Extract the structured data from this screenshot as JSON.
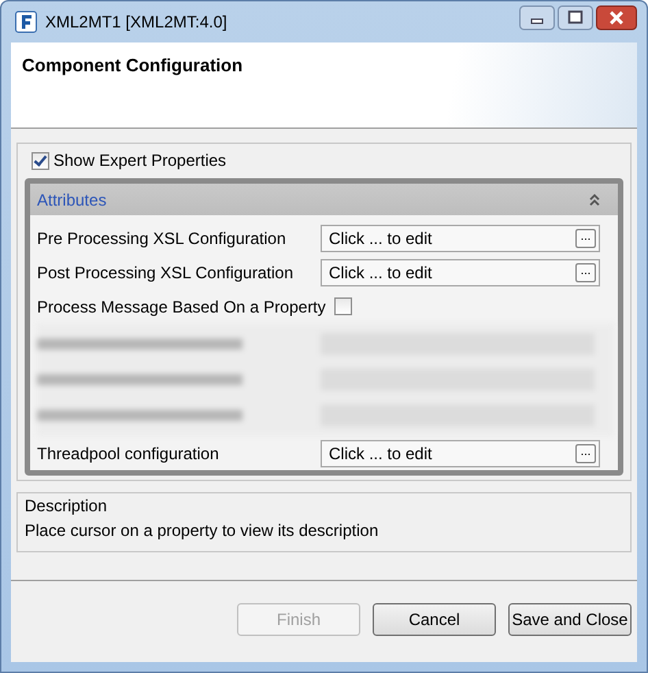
{
  "window": {
    "title": "XML2MT1 [XML2MT:4.0]"
  },
  "header": {
    "title": "Component Configuration"
  },
  "show_expert": {
    "label": "Show Expert Properties",
    "checked": true
  },
  "section": {
    "title": "Attributes",
    "expanded": true
  },
  "properties": [
    {
      "kind": "editor",
      "label": "Pre Processing XSL Configuration",
      "value": "Click ... to edit",
      "button": "..."
    },
    {
      "kind": "editor",
      "label": "Post Processing XSL Configuration",
      "value": "Click ... to edit",
      "button": "..."
    },
    {
      "kind": "checkbox",
      "label": "Process Message Based On a Property",
      "checked": false
    },
    {
      "kind": "redacted"
    },
    {
      "kind": "redacted"
    },
    {
      "kind": "redacted"
    },
    {
      "kind": "editor",
      "label": "Threadpool configuration",
      "value": "Click ... to edit",
      "button": "..."
    }
  ],
  "description": {
    "title": "Description",
    "text": "Place cursor on a property to view its description"
  },
  "buttons": [
    {
      "label": "Finish",
      "disabled": true
    },
    {
      "label": "Cancel",
      "disabled": false
    },
    {
      "label": "Save and Close",
      "disabled": false
    }
  ]
}
